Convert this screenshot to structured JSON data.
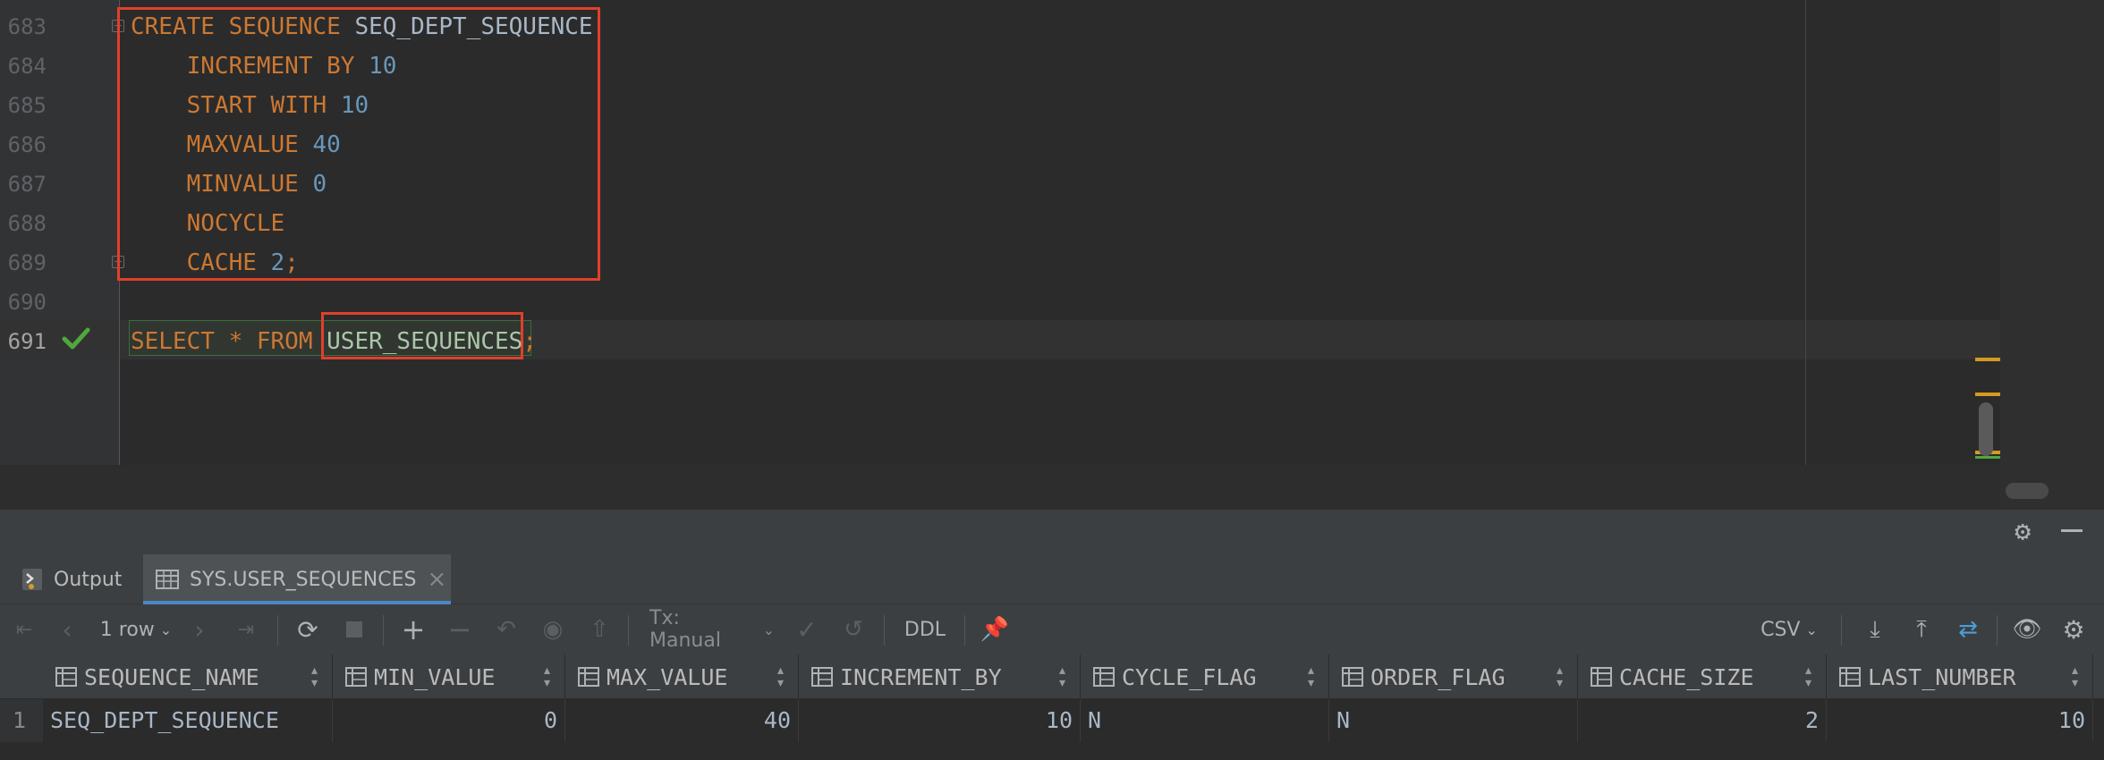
{
  "editor": {
    "lines": [
      {
        "num": "683",
        "tokens": [
          {
            "t": "CREATE SEQUENCE ",
            "c": "kw"
          },
          {
            "t": "SEQ_DEPT_SEQUENCE",
            "c": "id"
          }
        ]
      },
      {
        "num": "684",
        "tokens": [
          {
            "t": "    INCREMENT BY ",
            "c": "kw"
          },
          {
            "t": "10",
            "c": "num"
          }
        ]
      },
      {
        "num": "685",
        "tokens": [
          {
            "t": "    START WITH ",
            "c": "kw"
          },
          {
            "t": "10",
            "c": "num"
          }
        ]
      },
      {
        "num": "686",
        "tokens": [
          {
            "t": "    MAXVALUE ",
            "c": "kw"
          },
          {
            "t": "40",
            "c": "num"
          }
        ]
      },
      {
        "num": "687",
        "tokens": [
          {
            "t": "    MINVALUE ",
            "c": "kw"
          },
          {
            "t": "0",
            "c": "num"
          }
        ]
      },
      {
        "num": "688",
        "tokens": [
          {
            "t": "    NOCYCLE",
            "c": "kw"
          }
        ]
      },
      {
        "num": "689",
        "tokens": [
          {
            "t": "    CACHE ",
            "c": "kw"
          },
          {
            "t": "2",
            "c": "num"
          },
          {
            "t": ";",
            "c": "kw"
          }
        ]
      },
      {
        "num": "690",
        "tokens": []
      },
      {
        "num": "691",
        "tokens": [
          {
            "t": "SELECT * FROM ",
            "c": "kw"
          },
          {
            "t": "USER_SEQUENCES",
            "c": "tbl"
          },
          {
            "t": ";",
            "c": "kw"
          }
        ]
      }
    ]
  },
  "tabs": {
    "output": "Output",
    "result": "SYS.USER_SEQUENCES",
    "close": "×"
  },
  "toolbar": {
    "rows": "1 row",
    "tx": "Tx: Manual",
    "ddl": "DDL",
    "format": "CSV"
  },
  "grid": {
    "columns": [
      "SEQUENCE_NAME",
      "MIN_VALUE",
      "MAX_VALUE",
      "INCREMENT_BY",
      "CYCLE_FLAG",
      "ORDER_FLAG",
      "CACHE_SIZE",
      "LAST_NUMBER"
    ],
    "rows": [
      {
        "num": "1",
        "cells": [
          "SEQ_DEPT_SEQUENCE",
          "0",
          "40",
          "10",
          "N",
          "N",
          "2",
          "10"
        ]
      }
    ]
  },
  "colors": {
    "keyword": "#cc7832",
    "number": "#6897bb",
    "highlight_box": "#e0402a",
    "success": "#4fa83d"
  }
}
